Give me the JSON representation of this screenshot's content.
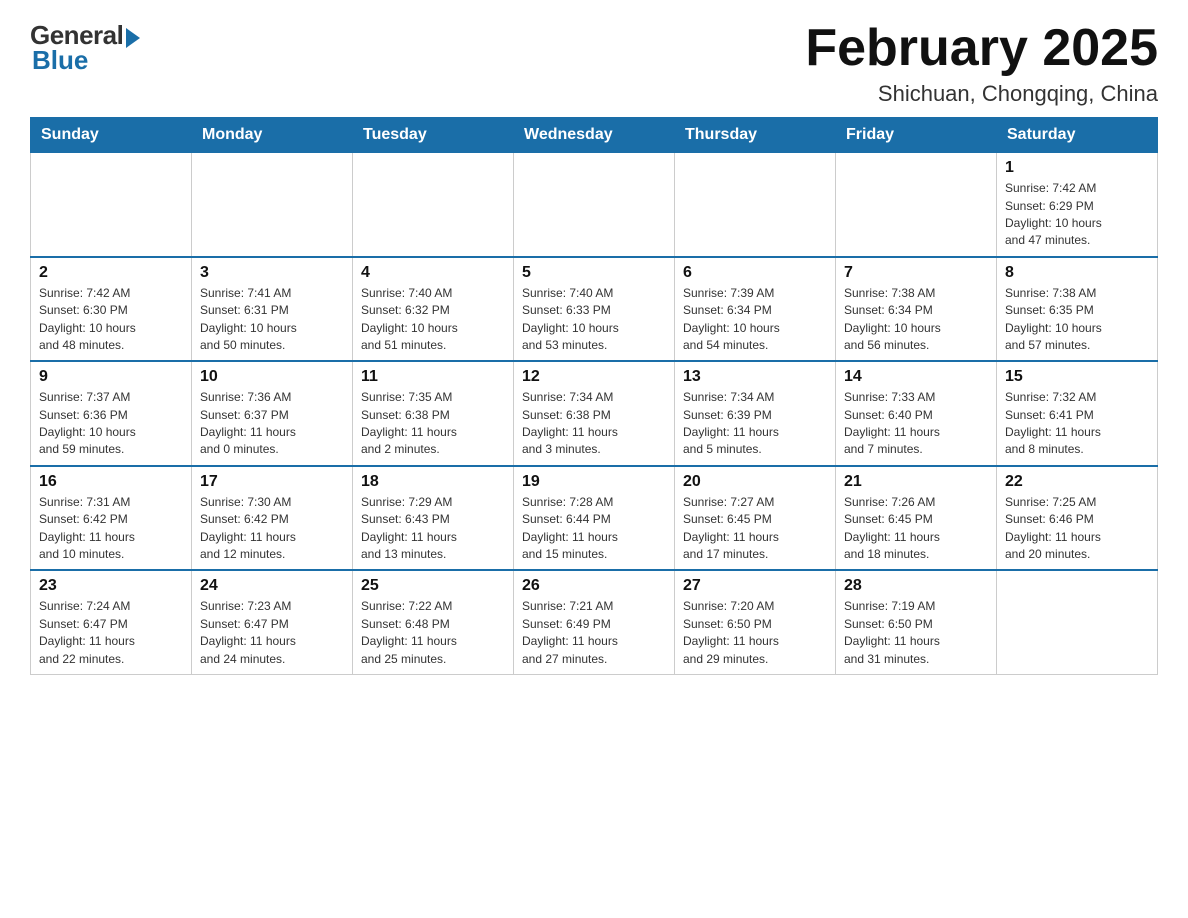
{
  "logo": {
    "general": "General",
    "blue": "Blue"
  },
  "title": "February 2025",
  "subtitle": "Shichuan, Chongqing, China",
  "days_of_week": [
    "Sunday",
    "Monday",
    "Tuesday",
    "Wednesday",
    "Thursday",
    "Friday",
    "Saturday"
  ],
  "weeks": [
    [
      {
        "day": "",
        "info": ""
      },
      {
        "day": "",
        "info": ""
      },
      {
        "day": "",
        "info": ""
      },
      {
        "day": "",
        "info": ""
      },
      {
        "day": "",
        "info": ""
      },
      {
        "day": "",
        "info": ""
      },
      {
        "day": "1",
        "info": "Sunrise: 7:42 AM\nSunset: 6:29 PM\nDaylight: 10 hours\nand 47 minutes."
      }
    ],
    [
      {
        "day": "2",
        "info": "Sunrise: 7:42 AM\nSunset: 6:30 PM\nDaylight: 10 hours\nand 48 minutes."
      },
      {
        "day": "3",
        "info": "Sunrise: 7:41 AM\nSunset: 6:31 PM\nDaylight: 10 hours\nand 50 minutes."
      },
      {
        "day": "4",
        "info": "Sunrise: 7:40 AM\nSunset: 6:32 PM\nDaylight: 10 hours\nand 51 minutes."
      },
      {
        "day": "5",
        "info": "Sunrise: 7:40 AM\nSunset: 6:33 PM\nDaylight: 10 hours\nand 53 minutes."
      },
      {
        "day": "6",
        "info": "Sunrise: 7:39 AM\nSunset: 6:34 PM\nDaylight: 10 hours\nand 54 minutes."
      },
      {
        "day": "7",
        "info": "Sunrise: 7:38 AM\nSunset: 6:34 PM\nDaylight: 10 hours\nand 56 minutes."
      },
      {
        "day": "8",
        "info": "Sunrise: 7:38 AM\nSunset: 6:35 PM\nDaylight: 10 hours\nand 57 minutes."
      }
    ],
    [
      {
        "day": "9",
        "info": "Sunrise: 7:37 AM\nSunset: 6:36 PM\nDaylight: 10 hours\nand 59 minutes."
      },
      {
        "day": "10",
        "info": "Sunrise: 7:36 AM\nSunset: 6:37 PM\nDaylight: 11 hours\nand 0 minutes."
      },
      {
        "day": "11",
        "info": "Sunrise: 7:35 AM\nSunset: 6:38 PM\nDaylight: 11 hours\nand 2 minutes."
      },
      {
        "day": "12",
        "info": "Sunrise: 7:34 AM\nSunset: 6:38 PM\nDaylight: 11 hours\nand 3 minutes."
      },
      {
        "day": "13",
        "info": "Sunrise: 7:34 AM\nSunset: 6:39 PM\nDaylight: 11 hours\nand 5 minutes."
      },
      {
        "day": "14",
        "info": "Sunrise: 7:33 AM\nSunset: 6:40 PM\nDaylight: 11 hours\nand 7 minutes."
      },
      {
        "day": "15",
        "info": "Sunrise: 7:32 AM\nSunset: 6:41 PM\nDaylight: 11 hours\nand 8 minutes."
      }
    ],
    [
      {
        "day": "16",
        "info": "Sunrise: 7:31 AM\nSunset: 6:42 PM\nDaylight: 11 hours\nand 10 minutes."
      },
      {
        "day": "17",
        "info": "Sunrise: 7:30 AM\nSunset: 6:42 PM\nDaylight: 11 hours\nand 12 minutes."
      },
      {
        "day": "18",
        "info": "Sunrise: 7:29 AM\nSunset: 6:43 PM\nDaylight: 11 hours\nand 13 minutes."
      },
      {
        "day": "19",
        "info": "Sunrise: 7:28 AM\nSunset: 6:44 PM\nDaylight: 11 hours\nand 15 minutes."
      },
      {
        "day": "20",
        "info": "Sunrise: 7:27 AM\nSunset: 6:45 PM\nDaylight: 11 hours\nand 17 minutes."
      },
      {
        "day": "21",
        "info": "Sunrise: 7:26 AM\nSunset: 6:45 PM\nDaylight: 11 hours\nand 18 minutes."
      },
      {
        "day": "22",
        "info": "Sunrise: 7:25 AM\nSunset: 6:46 PM\nDaylight: 11 hours\nand 20 minutes."
      }
    ],
    [
      {
        "day": "23",
        "info": "Sunrise: 7:24 AM\nSunset: 6:47 PM\nDaylight: 11 hours\nand 22 minutes."
      },
      {
        "day": "24",
        "info": "Sunrise: 7:23 AM\nSunset: 6:47 PM\nDaylight: 11 hours\nand 24 minutes."
      },
      {
        "day": "25",
        "info": "Sunrise: 7:22 AM\nSunset: 6:48 PM\nDaylight: 11 hours\nand 25 minutes."
      },
      {
        "day": "26",
        "info": "Sunrise: 7:21 AM\nSunset: 6:49 PM\nDaylight: 11 hours\nand 27 minutes."
      },
      {
        "day": "27",
        "info": "Sunrise: 7:20 AM\nSunset: 6:50 PM\nDaylight: 11 hours\nand 29 minutes."
      },
      {
        "day": "28",
        "info": "Sunrise: 7:19 AM\nSunset: 6:50 PM\nDaylight: 11 hours\nand 31 minutes."
      },
      {
        "day": "",
        "info": ""
      }
    ]
  ]
}
